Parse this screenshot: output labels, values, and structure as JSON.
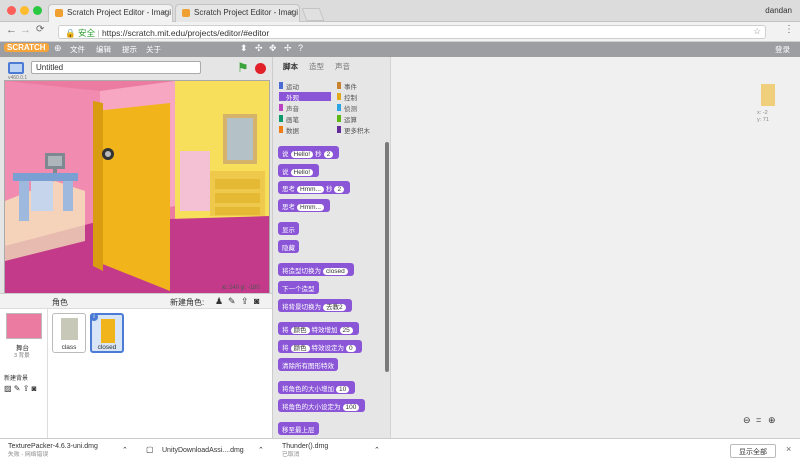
{
  "window": {
    "user": "dandan"
  },
  "tabs": [
    {
      "title": "Scratch Project Editor - Imagi"
    },
    {
      "title": "Scratch Project Editor - Imagi"
    }
  ],
  "address": {
    "secure_label": "安全",
    "url": "https://scratch.mit.edu/projects/editor/#editor"
  },
  "scratch_menu": {
    "logo": "SCRATCH",
    "file": "文件",
    "edit": "编辑",
    "tips": "提示",
    "about": "关于",
    "login": "登录"
  },
  "project": {
    "title": "Untitled",
    "version": "v460.0.1"
  },
  "stage": {
    "x_label": "x:",
    "x_value": "240",
    "y_label": "y:",
    "y_value": "-180"
  },
  "sprites_panel": {
    "title": "角色",
    "new_sprite": "新建角色:",
    "stage_label": "舞台",
    "stage_backdrops": "3 背景",
    "new_backdrop": "新建背景",
    "sprites": [
      {
        "name": "class"
      },
      {
        "name": "closed"
      }
    ]
  },
  "editor_tabs": [
    "脚本",
    "造型",
    "声音"
  ],
  "categories": [
    {
      "label": "运动",
      "color": "#4a6cd4"
    },
    {
      "label": "事件",
      "color": "#c88330"
    },
    {
      "label": "外观",
      "color": "#8a55d7"
    },
    {
      "label": "控制",
      "color": "#e1a91a"
    },
    {
      "label": "声音",
      "color": "#bb42c3"
    },
    {
      "label": "侦测",
      "color": "#2ca5e2"
    },
    {
      "label": "画笔",
      "color": "#0e9a6c"
    },
    {
      "label": "运算",
      "color": "#5cb712"
    },
    {
      "label": "数据",
      "color": "#ee7d16"
    },
    {
      "label": "更多积木",
      "color": "#632d99"
    }
  ],
  "blocks": [
    {
      "text": "说",
      "input": "Hello!",
      "after": "2",
      "tail": "秒"
    },
    {
      "text": "说",
      "input": "Hello!",
      "after": "",
      "tail": ""
    },
    {
      "text": "思考",
      "input": "Hmm...",
      "after": "2",
      "tail": "秒"
    },
    {
      "text": "思考",
      "input": "Hmm...",
      "after": "",
      "tail": ""
    },
    {
      "text": "显示",
      "input": "",
      "after": "",
      "tail": ""
    },
    {
      "text": "隐藏",
      "input": "",
      "after": "",
      "tail": ""
    },
    {
      "text": "将造型切换为",
      "input": "closed",
      "after": "",
      "tail": ""
    },
    {
      "text": "下一个造型",
      "input": "",
      "after": "",
      "tail": ""
    },
    {
      "text": "将背景切换为",
      "input": "去教2",
      "after": "",
      "tail": ""
    },
    {
      "text": "将",
      "input": "颜色",
      "after": "25",
      "tail": "特效增加"
    },
    {
      "text": "将",
      "input": "颜色",
      "after": "0",
      "tail": "特效设定为"
    },
    {
      "text": "清除所有图形特效",
      "input": "",
      "after": "",
      "tail": ""
    },
    {
      "text": "将角色的大小增加",
      "input": "",
      "after": "10",
      "tail": ""
    },
    {
      "text": "将角色的大小设定为",
      "input": "",
      "after": "100",
      "tail": ""
    },
    {
      "text": "移至最上层",
      "input": "",
      "after": "",
      "tail": ""
    }
  ],
  "sprite_info": {
    "x": "x: -2",
    "y": "y: 71"
  },
  "downloads": [
    {
      "name": "TexturePacker-4.6.3-uni.dmg",
      "status": "失败 - 网络错误"
    },
    {
      "name": "UnityDownloadAssi....dmg",
      "status": ""
    },
    {
      "name": "Thunder().dmg",
      "status": "已取消"
    }
  ],
  "show_all": "显示全部"
}
